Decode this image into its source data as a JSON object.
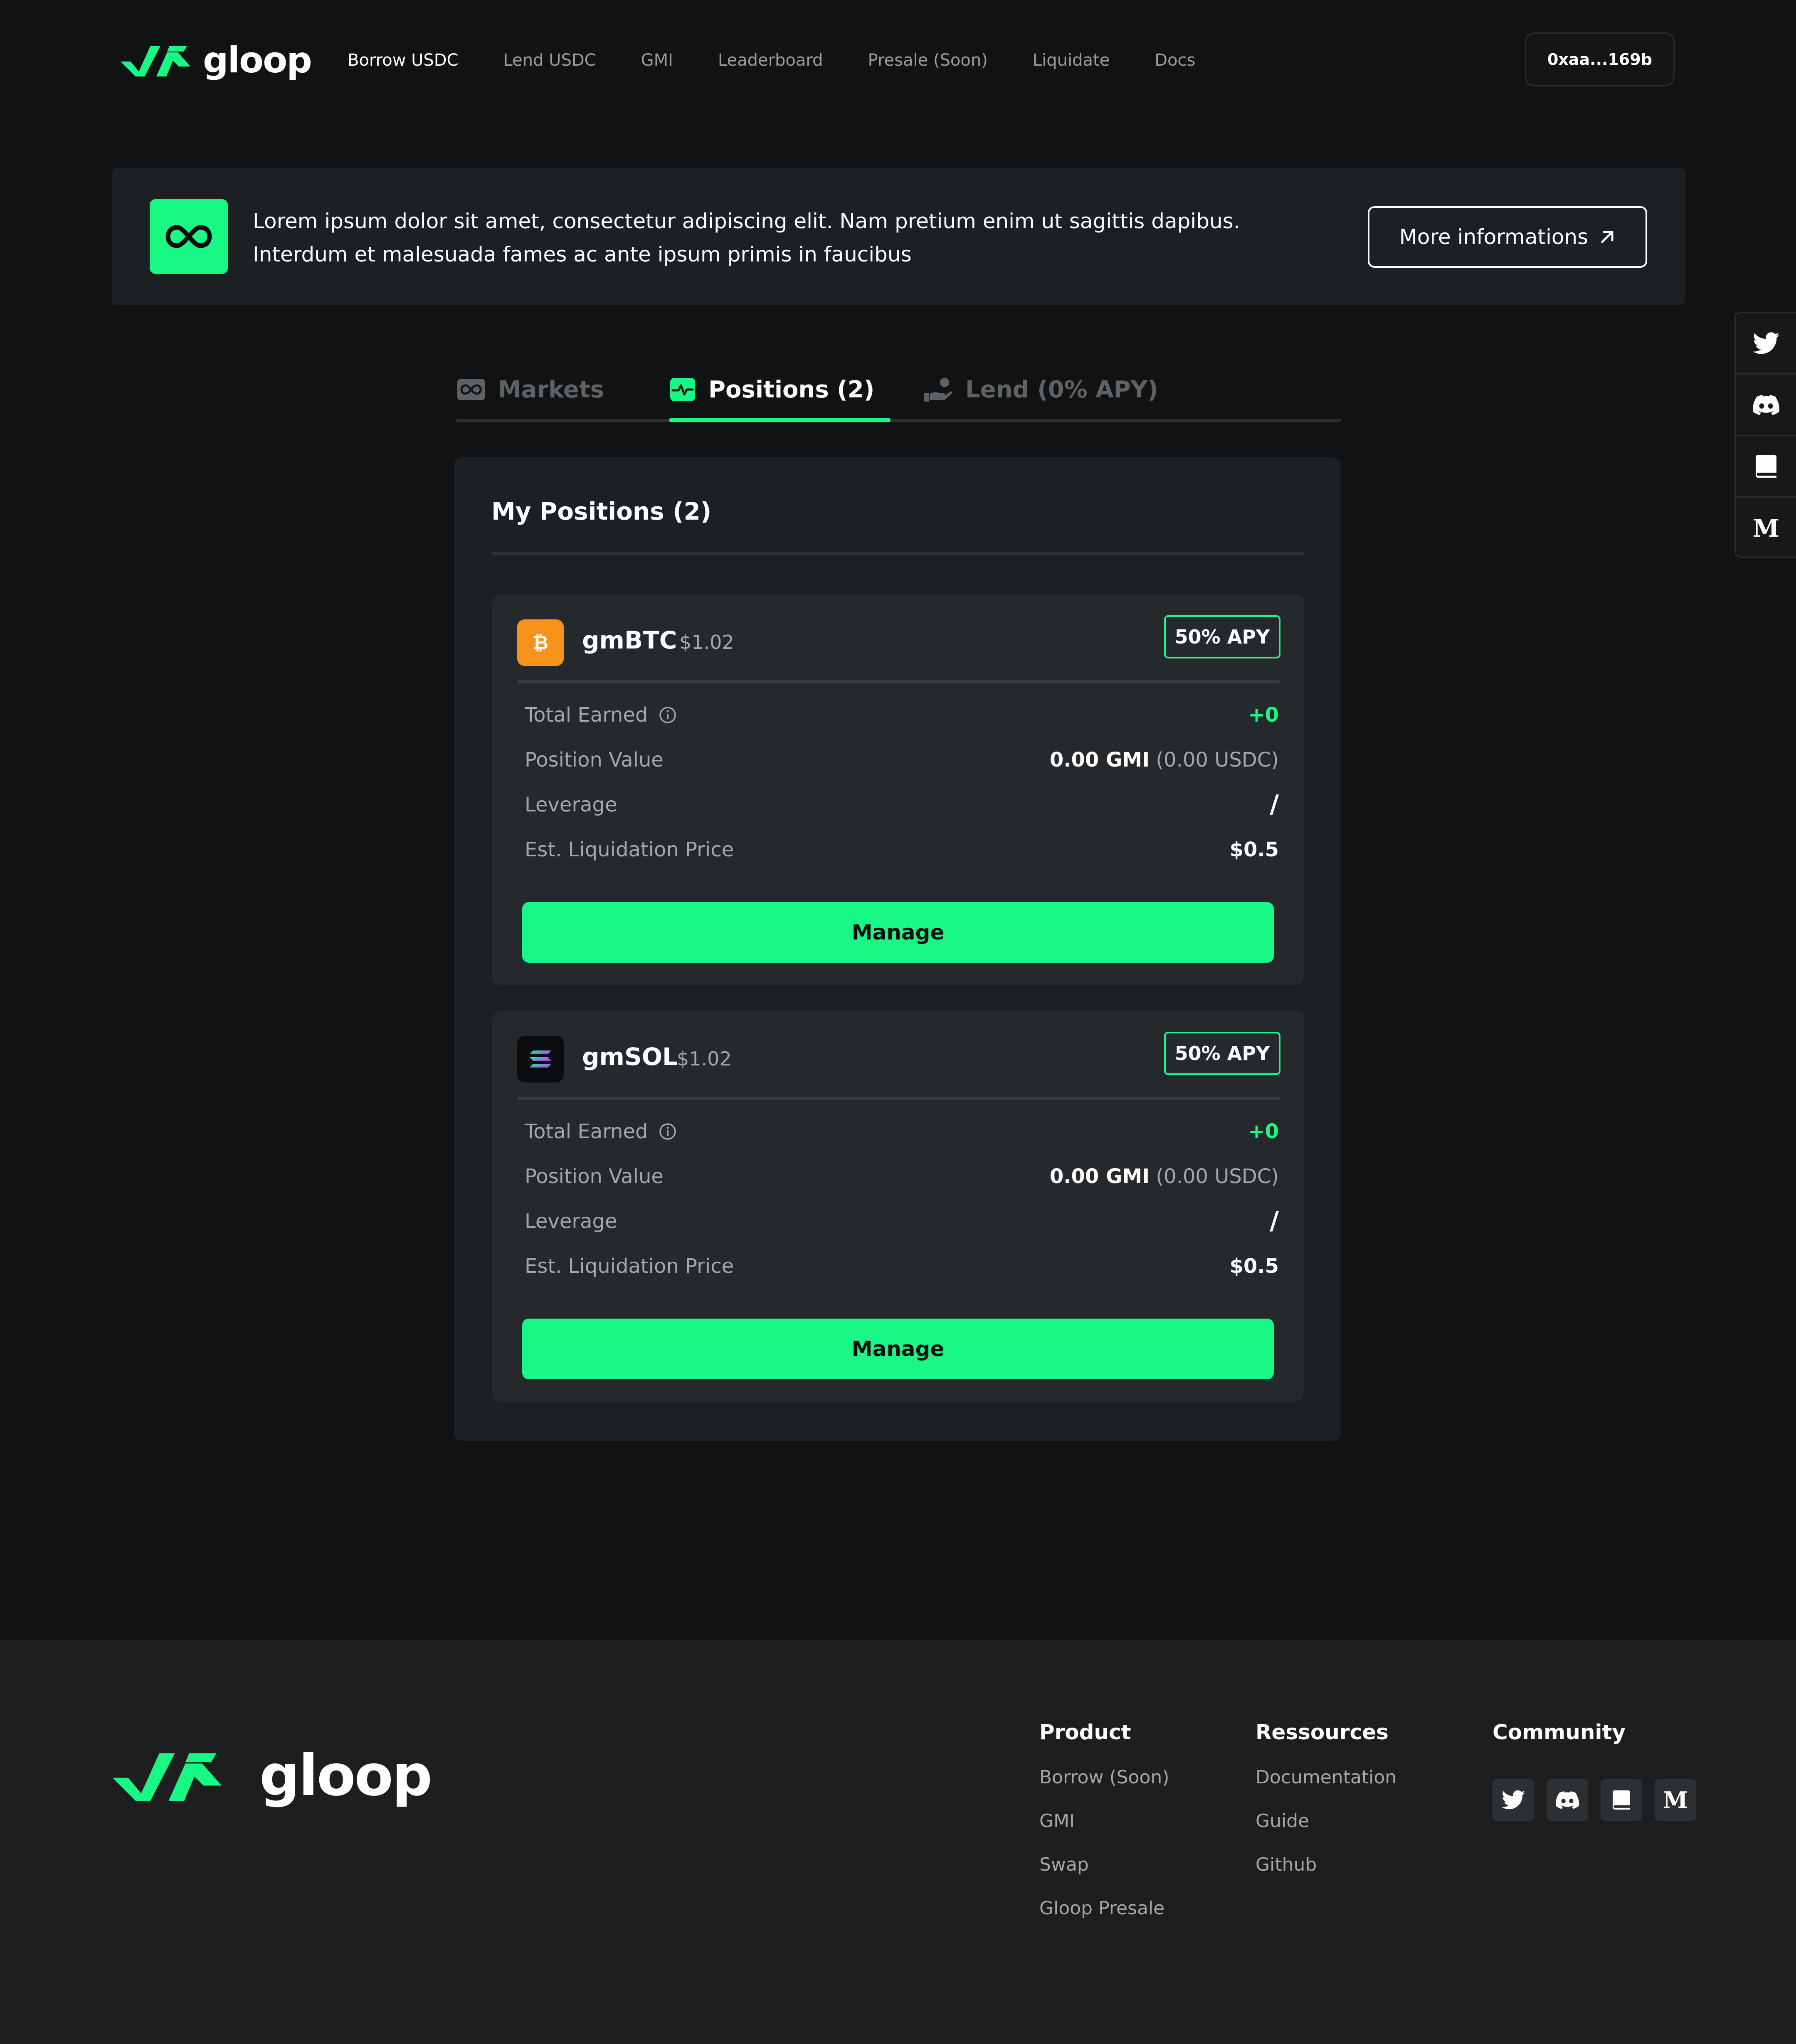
{
  "brand": {
    "name": "gloop",
    "accent": "#19f785"
  },
  "nav": {
    "links": [
      "Borrow USDC",
      "Lend USDC",
      "GMI",
      "Leaderboard",
      "Presale (Soon)",
      "Liquidate",
      "Docs"
    ],
    "wallet": "0xaa...169b"
  },
  "banner": {
    "line1": "Lorem ipsum dolor sit amet, consectetur adipiscing elit. Nam pretium enim ut sagittis dapibus.",
    "line2": "Interdum et malesuada fames ac ante ipsum primis in faucibus",
    "button": "More informations",
    "icon": "infinity-icon"
  },
  "social_rail": [
    "twitter-icon",
    "discord-icon",
    "book-icon",
    "medium-icon"
  ],
  "tabs": [
    {
      "label": "Markets",
      "icon": "infinity-icon",
      "active": false
    },
    {
      "label": "Positions (2)",
      "icon": "activity-icon",
      "active": true
    },
    {
      "label": "Lend (0% APY)",
      "icon": "hand-coins-icon",
      "active": false
    }
  ],
  "panel": {
    "title": "My Positions (2)",
    "positions": [
      {
        "name": "gmBTC",
        "price": "$1.02",
        "apy": "50% APY",
        "icon": "bitcoin-icon",
        "rows": {
          "total_earned_label": "Total Earned",
          "total_earned": "+0",
          "position_value_label": "Position Value",
          "position_value_gmi": "0.00 GMI",
          "position_value_usdc": "(0.00 USDC)",
          "leverage_label": "Leverage",
          "leverage": "/",
          "liq_label": "Est. Liquidation Price",
          "liq": "$0.5"
        },
        "button": "Manage"
      },
      {
        "name": "gmSOL",
        "price": "$1.02",
        "apy": "50% APY",
        "icon": "solana-icon",
        "rows": {
          "total_earned_label": "Total Earned",
          "total_earned": "+0",
          "position_value_label": "Position Value",
          "position_value_gmi": "0.00 GMI",
          "position_value_usdc": "(0.00 USDC)",
          "leverage_label": "Leverage",
          "leverage": "/",
          "liq_label": "Est. Liquidation Price",
          "liq": "$0.5"
        },
        "button": "Manage"
      }
    ]
  },
  "footer": {
    "product": {
      "title": "Product",
      "links": [
        "Borrow (Soon)",
        "GMI",
        "Swap",
        "Gloop Presale"
      ]
    },
    "resources": {
      "title": "Ressources",
      "links": [
        "Documentation",
        "Guide",
        "Github"
      ]
    },
    "community": {
      "title": "Community",
      "icons": [
        "twitter-icon",
        "discord-icon",
        "book-icon",
        "medium-icon"
      ]
    }
  }
}
